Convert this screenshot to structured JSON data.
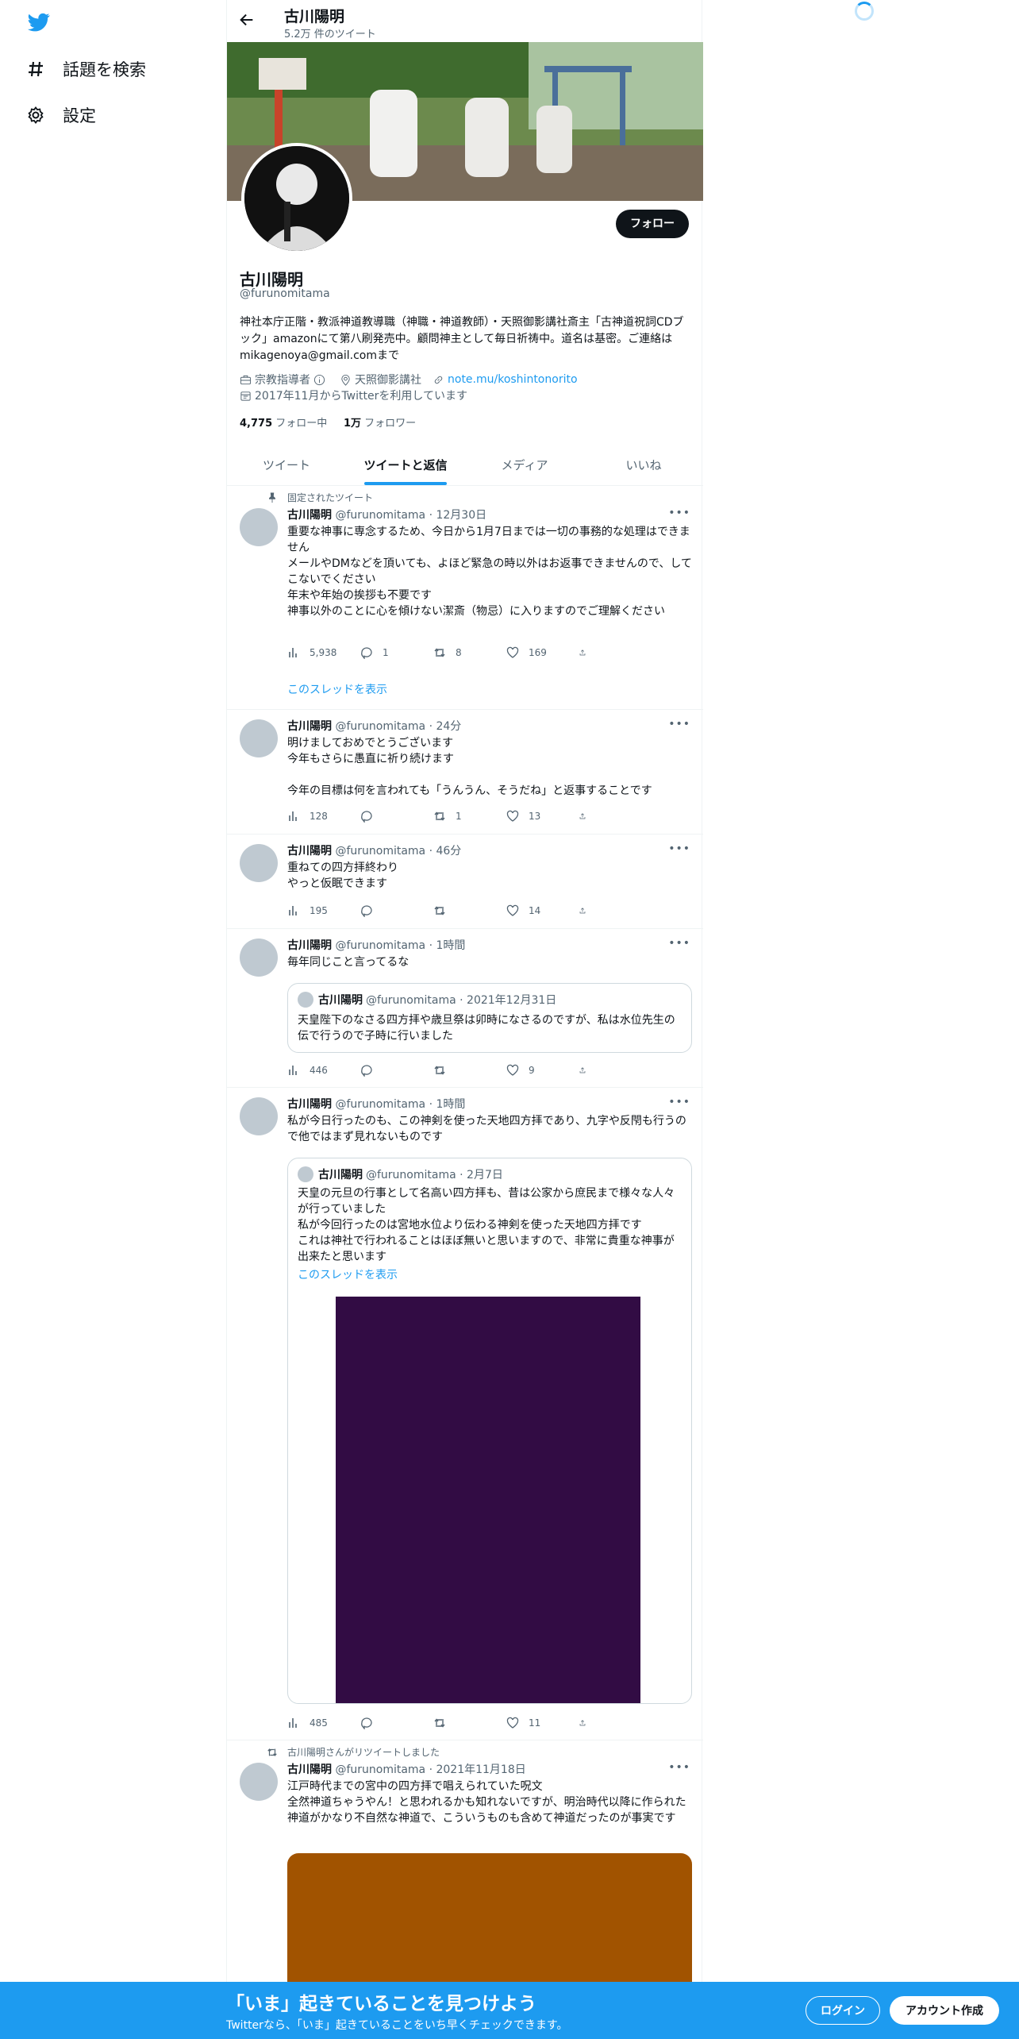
{
  "nav": {
    "explore_label": "話題を検索",
    "settings_label": "設定"
  },
  "header": {
    "title": "古川陽明",
    "tweet_count": "5.2万 件のツイート"
  },
  "profile": {
    "name": "古川陽明",
    "handle": "@furunomitama",
    "follow_label": "フォロー",
    "bio": "神社本庁正階・教派神道教導職（神職・神道教師）・天照御影講社斎主「古神道祝詞CDブック」amazonにて第八刷発売中。顧問神主として毎日祈祷中。道名は基密。ご連絡はmikagenoya@gmail.comまで",
    "category": "宗教指導者",
    "location": "天照御影講社",
    "link": "note.mu/koshintonorito",
    "joined": "2017年11月からTwitterを利用しています",
    "following_count": "4,775",
    "following_label": "フォロー中",
    "followers_count": "1万",
    "followers_label": "フォロワー"
  },
  "tabs": [
    "ツイート",
    "ツイートと返信",
    "メディア",
    "いいね"
  ],
  "tweets": [
    {
      "context": "固定されたツイート",
      "name": "古川陽明",
      "meta": "@furunomitama · 12月30日",
      "body": "重要な神事に専念するため、今日から1月7日までは一切の事務的な処理はできません\nメールやDMなどを頂いても、よほど緊急の時以外はお返事できませんので、してこないでください\n年末や年始の挨拶も不要です\n神事以外のことに心を傾けない潔斎（物忌）に入りますのでご理解ください",
      "views": "5,938",
      "replies": "1",
      "retweets": "8",
      "likes": "169",
      "thread_label": "このスレッドを表示"
    },
    {
      "name": "古川陽明",
      "meta": "@furunomitama · 24分",
      "body": "明けましておめでとうございます\n今年もさらに愚直に祈り続けます\n\n今年の目標は何を言われても「うんうん、そうだね」と返事することです",
      "views": "128",
      "replies": "",
      "retweets": "1",
      "likes": "13"
    },
    {
      "name": "古川陽明",
      "meta": "@furunomitama · 46分",
      "body": "重ねての四方拝終わり\nやっと仮眠できます",
      "views": "195",
      "replies": "",
      "retweets": "",
      "likes": "14"
    },
    {
      "name": "古川陽明",
      "meta": "@furunomitama · 1時間",
      "body": "毎年同じこと言ってるな",
      "quote": {
        "name": "古川陽明",
        "meta": "@furunomitama · 2021年12月31日",
        "body": "天皇陛下のなさる四方拝や歳旦祭は卯時になさるのですが、私は水位先生の伝で行うので子時に行いました"
      },
      "views": "446",
      "replies": "",
      "retweets": "",
      "likes": "9"
    },
    {
      "name": "古川陽明",
      "meta": "@furunomitama · 1時間",
      "body": "私が今日行ったのも、この神剣を使った天地四方拝であり、九字や反閇も行うので他ではまず見れないものです",
      "quote": {
        "name": "古川陽明",
        "meta": "@furunomitama · 2月7日",
        "body": "天皇の元旦の行事として名高い四方拝も、昔は公家から庶民まで様々な人々が行っていました\n私が今回行ったのは宮地水位より伝わる神剣を使った天地四方拝です\nこれは神社で行われることはほぼ無いと思いますので、非常に貴重な神事が出来たと思います",
        "thread_label": "このスレッドを表示",
        "image_color": "#320c44"
      },
      "views": "485",
      "replies": "",
      "retweets": "",
      "likes": "11"
    },
    {
      "context": "古川陽明さんがリツイートしました",
      "name": "古川陽明",
      "meta": "@furunomitama · 2021年11月18日",
      "body": "江戸時代までの宮中の四方拝で唱えられていた呪文\n全然神道ちゃうやん！と思われるかも知れないですが、明治時代以降に作られた神道がかなり不自然な神道で、こういうものも含めて神道だったのが事実です",
      "image_color": "#a15300"
    }
  ],
  "bottom_bar": {
    "title": "「いま」起きていることを見つけよう",
    "subtitle": "Twitterなら、「いま」起きていることをいち早くチェックできます。",
    "login_label": "ログイン",
    "signup_label": "アカウント作成"
  },
  "colors": {
    "accent": "#1d9bf0",
    "bottom_bar": "#1d9bf0"
  }
}
